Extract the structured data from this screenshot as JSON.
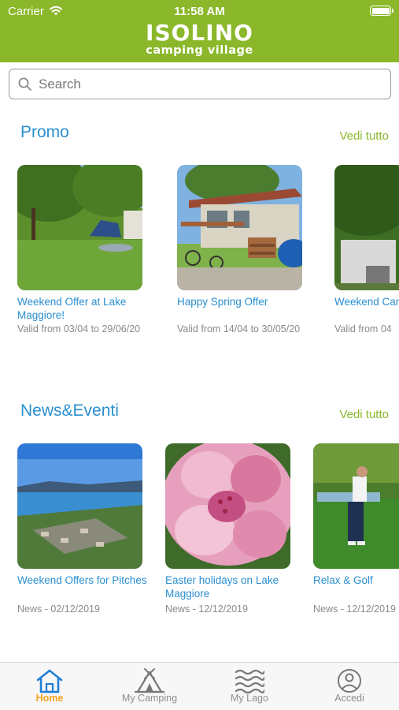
{
  "status_bar": {
    "carrier": "Carrier",
    "time": "11:58 AM"
  },
  "header": {
    "logo_main": "ISOLINO",
    "logo_sub": "camping village",
    "color": "#8ab82a"
  },
  "search": {
    "placeholder": "Search",
    "value": ""
  },
  "promo": {
    "title": "Promo",
    "see_all": "Vedi tutto",
    "items": [
      {
        "title": "Weekend Offer at Lake Maggiore!",
        "subtitle": "Valid from 03/04 to 29/06/20",
        "image": "camping-meadow-photo"
      },
      {
        "title": "Happy Spring Offer",
        "subtitle": "Valid from 14/04 to 30/05/20",
        "image": "mobile-home-photo"
      },
      {
        "title": "Weekend Camping in September",
        "subtitle": "Valid from 04",
        "image": "caravan-photo"
      }
    ]
  },
  "news": {
    "title": "News&Eventi",
    "see_all": "Vedi tutto",
    "items": [
      {
        "title": "Weekend Offers for Pitches",
        "subtitle": "News - 02/12/2019",
        "image": "aerial-lake-photo"
      },
      {
        "title": "Easter holidays on Lake Maggiore",
        "subtitle": "News - 12/12/2019",
        "image": "pink-flower-photo"
      },
      {
        "title": "Relax & Golf",
        "subtitle": "News - 12/12/2019",
        "image": "golf-photo"
      }
    ]
  },
  "tabbar": {
    "items": [
      {
        "label": "Home",
        "icon": "home-icon",
        "active": true
      },
      {
        "label": "My Camping",
        "icon": "tent-icon",
        "active": false
      },
      {
        "label": "My Lago",
        "icon": "waves-icon",
        "active": false
      },
      {
        "label": "Accedi",
        "icon": "user-icon",
        "active": false
      }
    ],
    "active_color": "#f3a21b",
    "inactive_color": "#8e8e8e"
  }
}
